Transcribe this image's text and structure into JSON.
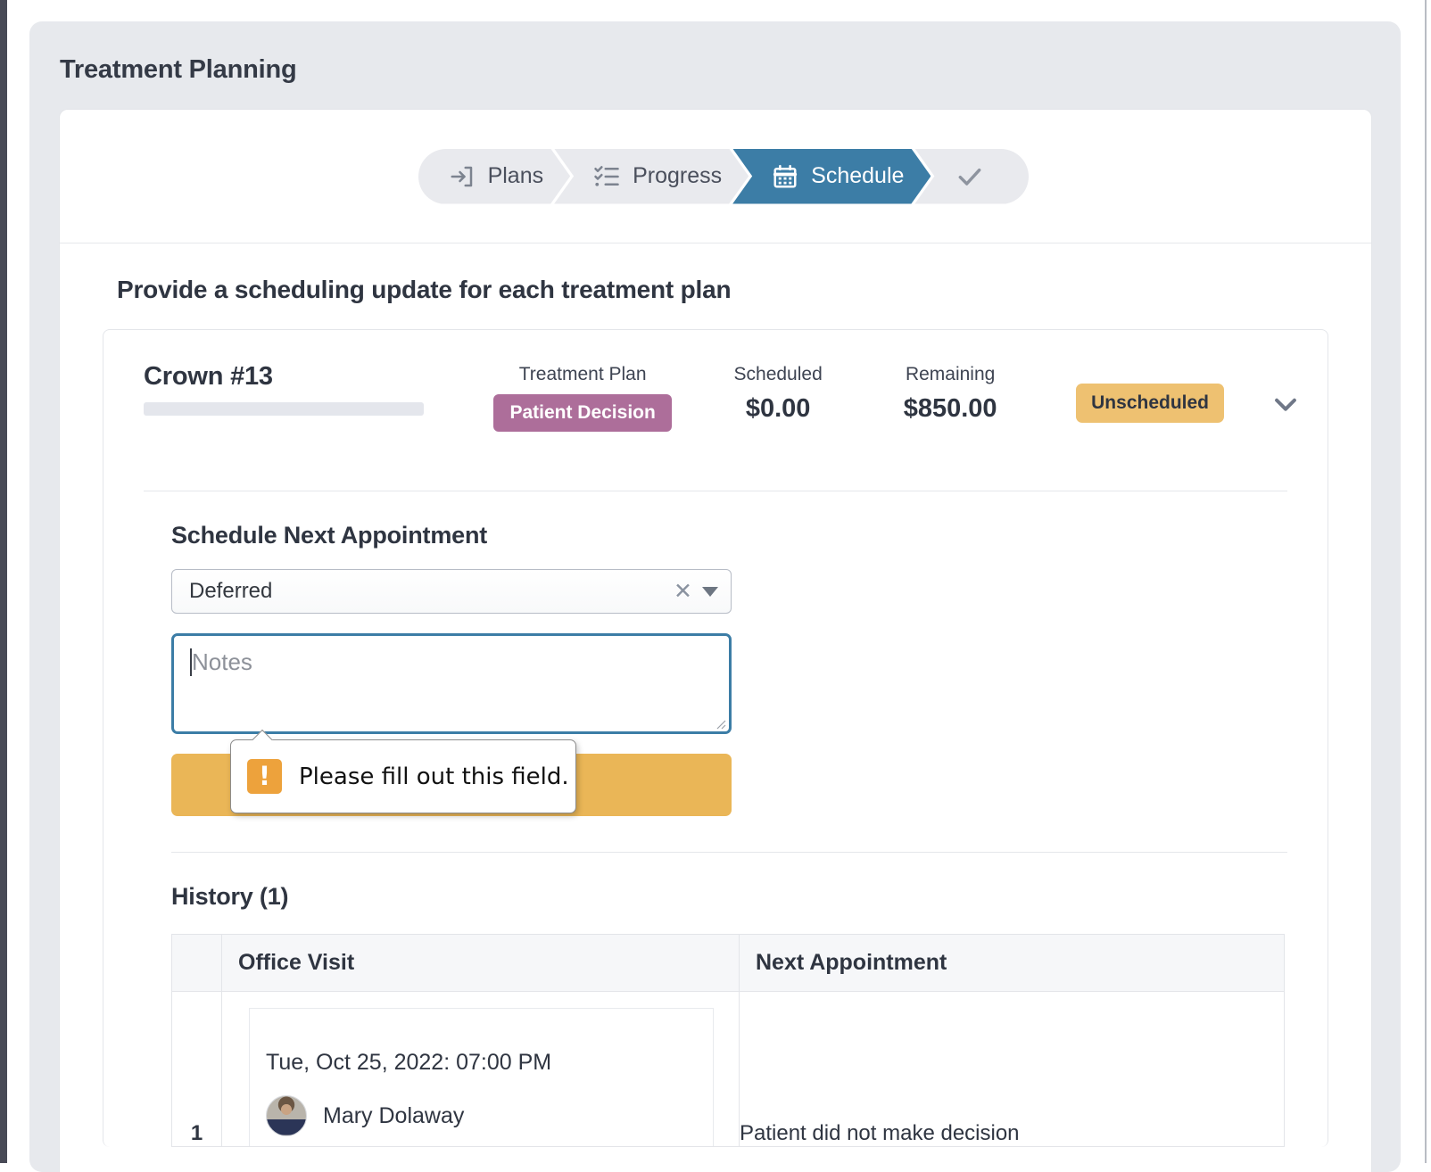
{
  "page": {
    "title": "Treatment Planning",
    "section_heading": "Provide a scheduling update for each treatment plan"
  },
  "stepper": {
    "steps": [
      {
        "label": "Plans",
        "icon": "sign-in-icon",
        "state": "inactive"
      },
      {
        "label": "Progress",
        "icon": "checklist-icon",
        "state": "inactive"
      },
      {
        "label": "Schedule",
        "icon": "calendar-icon",
        "state": "active"
      },
      {
        "label": "",
        "icon": "check-icon",
        "state": "inactive"
      }
    ],
    "active_color": "#3c7da6",
    "inactive_color": "#e9eaee"
  },
  "plan": {
    "name": "Crown #13",
    "treatment_plan_label": "Treatment Plan",
    "treatment_plan_badge": "Patient Decision",
    "treatment_plan_badge_color": "#ad6e9a",
    "scheduled_label": "Scheduled",
    "scheduled_value": "$0.00",
    "remaining_label": "Remaining",
    "remaining_value": "$850.00",
    "status_badge": "Unscheduled",
    "status_badge_color": "#eec171",
    "collapse_icon": "chevron-down-icon"
  },
  "schedule_next": {
    "title": "Schedule Next Appointment",
    "select_value": "Deferred",
    "clear_icon": "close-icon",
    "caret_icon": "chevron-down-icon",
    "notes_placeholder": "Notes",
    "notes_value": "",
    "submit_label": "",
    "submit_color": "#eab657"
  },
  "validation_tooltip": {
    "message": "Please fill out this field.",
    "icon": "warning-icon",
    "icon_color": "#eda23c"
  },
  "history": {
    "title": "History (1)",
    "columns": [
      "Office Visit",
      "Next Appointment"
    ],
    "rows": [
      {
        "index": "1",
        "visit_date": "Tue, Oct 25, 2022: 07:00 PM",
        "provider": "Mary Dolaway",
        "provider_avatar": "avatar-photo",
        "next_appointment": "Patient did not make decision"
      }
    ]
  }
}
